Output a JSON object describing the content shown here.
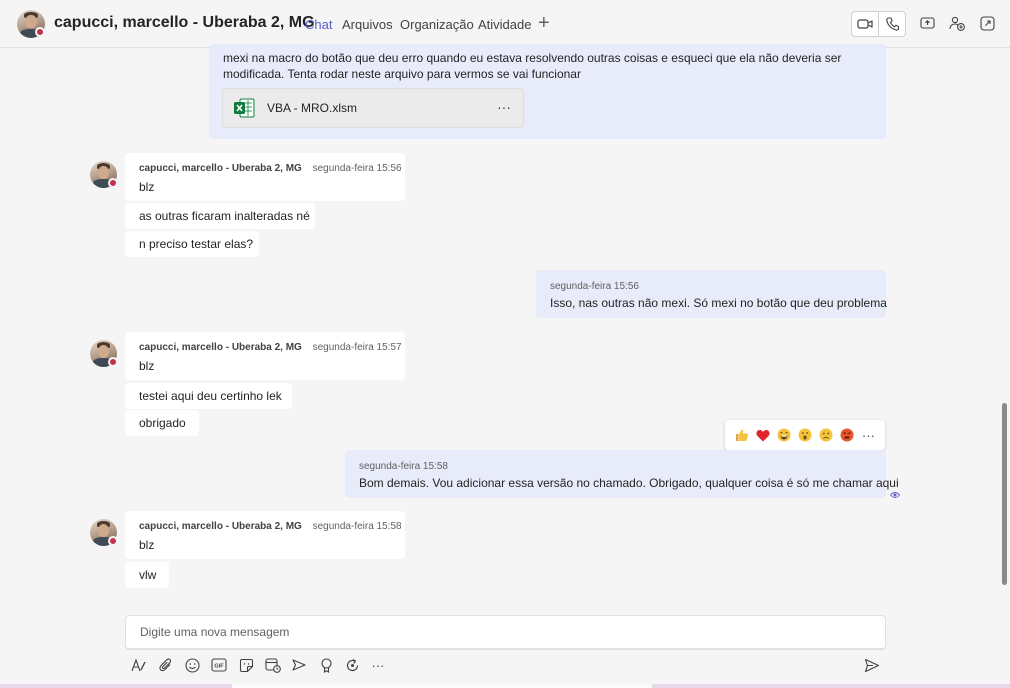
{
  "header": {
    "contact_name": "capucci, marcello - Uberaba 2, MG",
    "tabs": [
      {
        "label": "Chat",
        "active": true
      },
      {
        "label": "Arquivos"
      },
      {
        "label": "Organização"
      },
      {
        "label": "Atividade"
      }
    ],
    "add_tab_icon": "plus-icon",
    "actions": [
      "video-call-icon",
      "audio-call-icon",
      "share-screen-icon",
      "add-people-icon",
      "pop-out-icon"
    ]
  },
  "messages": {
    "top_out": {
      "text_line1": "mexi na macro do botão que deu erro quando eu estava resolvendo outras coisas e esqueci que ela não deveria ser",
      "text_line2": "modificada. Tenta rodar neste arquivo para vermos se vai funcionar",
      "file_name": "VBA - MRO.xlsm",
      "file_icon": "excel-file-icon"
    },
    "group1": {
      "sender": "capucci, marcello - Uberaba 2, MG",
      "time": "segunda-feira 15:56",
      "lines": [
        "blz",
        "as outras ficaram inalteradas né",
        "n preciso testar elas?"
      ]
    },
    "out1": {
      "time": "segunda-feira 15:56",
      "text": "Isso, nas outras não mexi. Só mexi no botão que deu problema"
    },
    "group2": {
      "sender": "capucci, marcello - Uberaba 2, MG",
      "time": "segunda-feira 15:57",
      "lines": [
        "blz",
        "testei aqui deu certinho lek",
        "obrigado"
      ]
    },
    "out2": {
      "time": "segunda-feira 15:58",
      "text": "Bom demais. Vou adicionar essa versão no chamado. Obrigado, qualquer coisa é só me chamar aqui",
      "status_icon": "seen-eye-icon"
    },
    "group3": {
      "sender": "capucci, marcello - Uberaba 2, MG",
      "time": "segunda-feira 15:58",
      "lines": [
        "blz",
        "vlw"
      ]
    }
  },
  "reactions": [
    "like-icon",
    "heart-icon",
    "laugh-icon",
    "surprised-icon",
    "sad-icon",
    "angry-icon",
    "more-options-icon"
  ],
  "composer": {
    "placeholder": "Digite uma nova mensagem",
    "tools": [
      "format-icon",
      "attach-icon",
      "emoji-icon",
      "gif-icon",
      "sticker-icon",
      "schedule-meeting-icon",
      "stream-icon",
      "praise-icon",
      "loop-icon",
      "more-apps-icon"
    ],
    "send_icon": "send-icon"
  },
  "colors": {
    "accent": "#5b5fc7",
    "outgoing_bubble": "#e8ebfa",
    "presence_busy": "#c4314b",
    "excel_green": "#107c41"
  }
}
